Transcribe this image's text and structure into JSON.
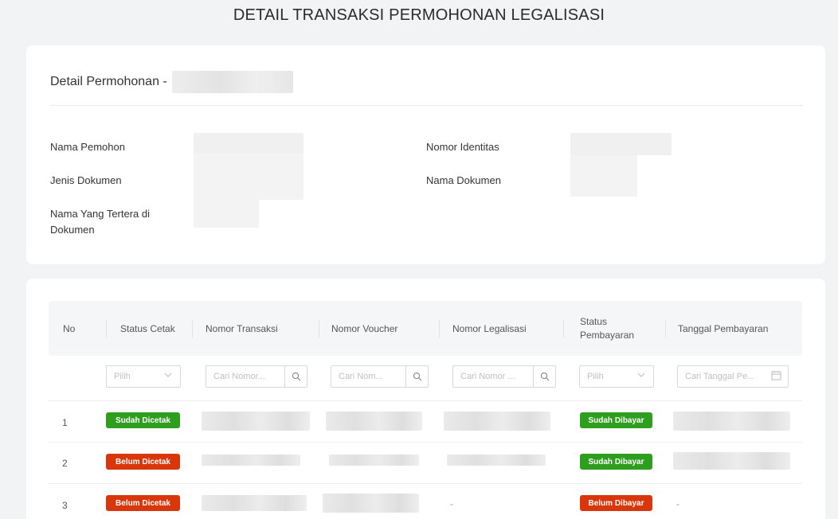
{
  "page": {
    "title": "DETAIL TRANSAKSI PERMOHONAN LEGALISASI"
  },
  "detail": {
    "heading": "Detail Permohonan -",
    "fields": {
      "nama_pemohon": "Nama Pemohon",
      "nomor_identitas": "Nomor Identitas",
      "jenis_dokumen": "Jenis Dokumen",
      "nama_dokumen": "Nama Dokumen",
      "nama_tertera": "Nama Yang Tertera di Dokumen"
    }
  },
  "table": {
    "columns": {
      "no": "No",
      "status_cetak": "Status Cetak",
      "nomor_transaksi": "Nomor Transaksi",
      "nomor_voucher": "Nomor Voucher",
      "nomor_legalisasi": "Nomor Legalisasi",
      "status_pembayaran": "Status Pembayaran",
      "tanggal_pembayaran": "Tanggal Pembayaran"
    },
    "filters": {
      "status_cetak": "Pilih",
      "nomor_transaksi": "Cari Nomor...",
      "nomor_voucher": "Cari Nom...",
      "nomor_legalisasi": "Cari Nomor ...",
      "status_pembayaran": "Pilih",
      "tanggal_pembayaran": "Cari Tanggal Pe..."
    },
    "rows": [
      {
        "no": "1",
        "status_cetak": "Sudah Dicetak",
        "status_pembayaran": "Sudah Dibayar",
        "nomor_legalisasi": "",
        "tanggal_pembayaran": ""
      },
      {
        "no": "2",
        "status_cetak": "Belum Dicetak",
        "status_pembayaran": "Sudah Dibayar",
        "nomor_legalisasi": "",
        "tanggal_pembayaran": ""
      },
      {
        "no": "3",
        "status_cetak": "Belum Dicetak",
        "status_pembayaran": "Belum Dibayar",
        "nomor_legalisasi": "-",
        "tanggal_pembayaran": "-"
      }
    ]
  },
  "colors": {
    "success": "#2e9e1f",
    "danger": "#d9360b",
    "background": "#f2f3f5"
  },
  "icons": {
    "search": "search-icon",
    "select": "chevron-down-icon",
    "date": "calendar-icon"
  }
}
